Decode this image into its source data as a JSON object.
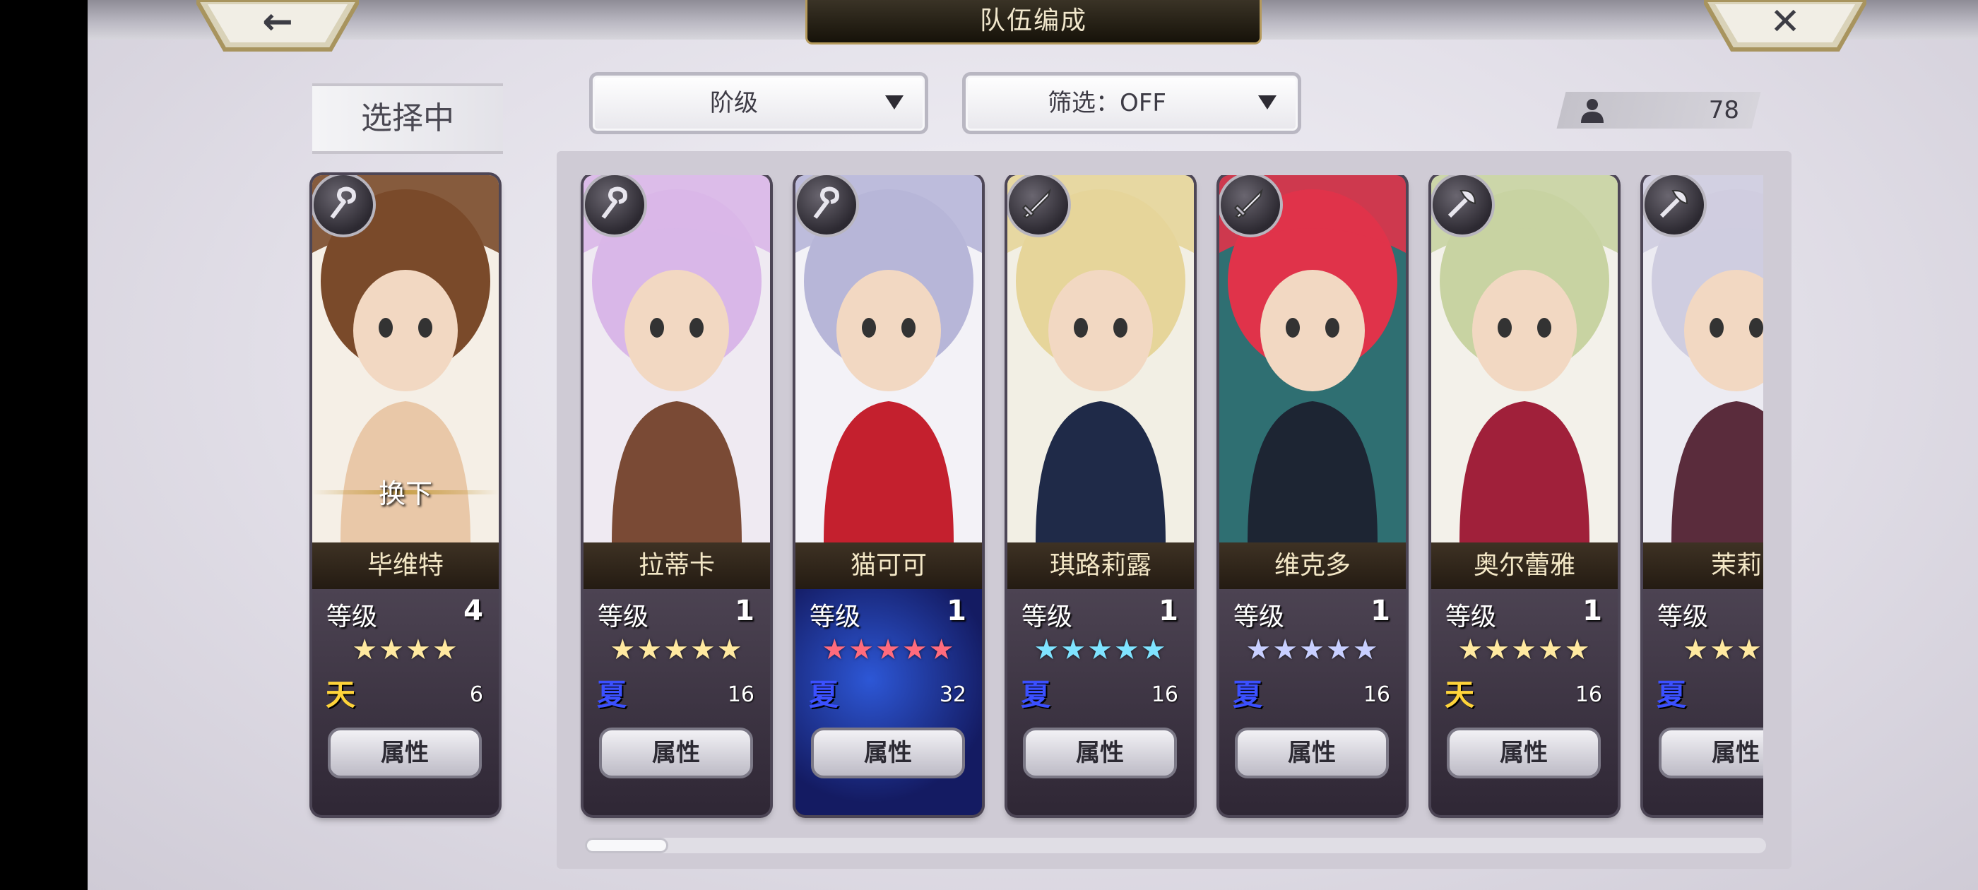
{
  "header": {
    "title": "队伍编成",
    "back_icon": "left-arrow-icon",
    "close_icon": "close-x-icon",
    "back_glyph": "←",
    "close_glyph": "✕"
  },
  "selected_label": "选择中",
  "filters": {
    "sort": {
      "label": "阶级"
    },
    "filter": {
      "label": "筛选：OFF"
    }
  },
  "unit_count": {
    "icon": "person-icon",
    "value": "78"
  },
  "selected_card": {
    "name": "毕维特",
    "level_label": "等级",
    "level": "4",
    "stars": "★★★★",
    "star_color": "#ffe9a0",
    "element": "天",
    "element_color": "#ffd43a",
    "cost": "6",
    "attr_button": "属性",
    "swap_text": "换下",
    "weapon_icon": "staff-icon",
    "palette": [
      "#f5efe6",
      "#7a4a2a",
      "#e9c8a8"
    ]
  },
  "roster": [
    {
      "name": "拉蒂卡",
      "level_label": "等级",
      "level": "1",
      "stars": "★★★★★",
      "star_color": "#ffe9a0",
      "element": "夏",
      "element_color": "#3b50ff",
      "cost": "16",
      "attr_button": "属性",
      "weapon_icon": "staff-icon",
      "palette": [
        "#efeaf2",
        "#d9b7e8",
        "#7a4a35"
      ]
    },
    {
      "name": "猫可可",
      "level_label": "等级",
      "level": "1",
      "stars": "★★★★★",
      "star_color": "#ff6b7d",
      "element": "夏",
      "element_color": "#3b50ff",
      "cost": "32",
      "attr_button": "属性",
      "weapon_icon": "staff-icon",
      "palette": [
        "#f3f2f7",
        "#b7b6d8",
        "#c4202e"
      ]
    },
    {
      "name": "琪路莉露",
      "level_label": "等级",
      "level": "1",
      "stars": "★★★★★",
      "star_color": "#7fe3ff",
      "element": "夏",
      "element_color": "#3b50ff",
      "cost": "16",
      "attr_button": "属性",
      "weapon_icon": "sword-icon",
      "palette": [
        "#f2efe4",
        "#e6d59a",
        "#1f2a48"
      ]
    },
    {
      "name": "维克多",
      "level_label": "等级",
      "level": "1",
      "stars": "★★★★★",
      "star_color": "#c8cfff",
      "element": "夏",
      "element_color": "#3b50ff",
      "cost": "16",
      "attr_button": "属性",
      "weapon_icon": "sword-icon",
      "palette": [
        "#2f6f72",
        "#e0334a",
        "#1d2533"
      ]
    },
    {
      "name": "奥尔蕾雅",
      "level_label": "等级",
      "level": "1",
      "stars": "★★★★★",
      "star_color": "#ffe9a0",
      "element": "天",
      "element_color": "#ffd43a",
      "cost": "16",
      "attr_button": "属性",
      "weapon_icon": "axe-icon",
      "palette": [
        "#f3f1ea",
        "#c8d3a2",
        "#a0203a"
      ]
    },
    {
      "name": "茉莉",
      "level_label": "等级",
      "level": "",
      "stars": "★★★★",
      "star_color": "#ffe9a0",
      "element": "夏",
      "element_color": "#3b50ff",
      "cost": "",
      "attr_button": "属性",
      "weapon_icon": "axe-icon",
      "palette": [
        "#ecebf2",
        "#cfcde0",
        "#5a2c3c"
      ]
    }
  ],
  "scrollbar": {
    "position": 0.0
  }
}
